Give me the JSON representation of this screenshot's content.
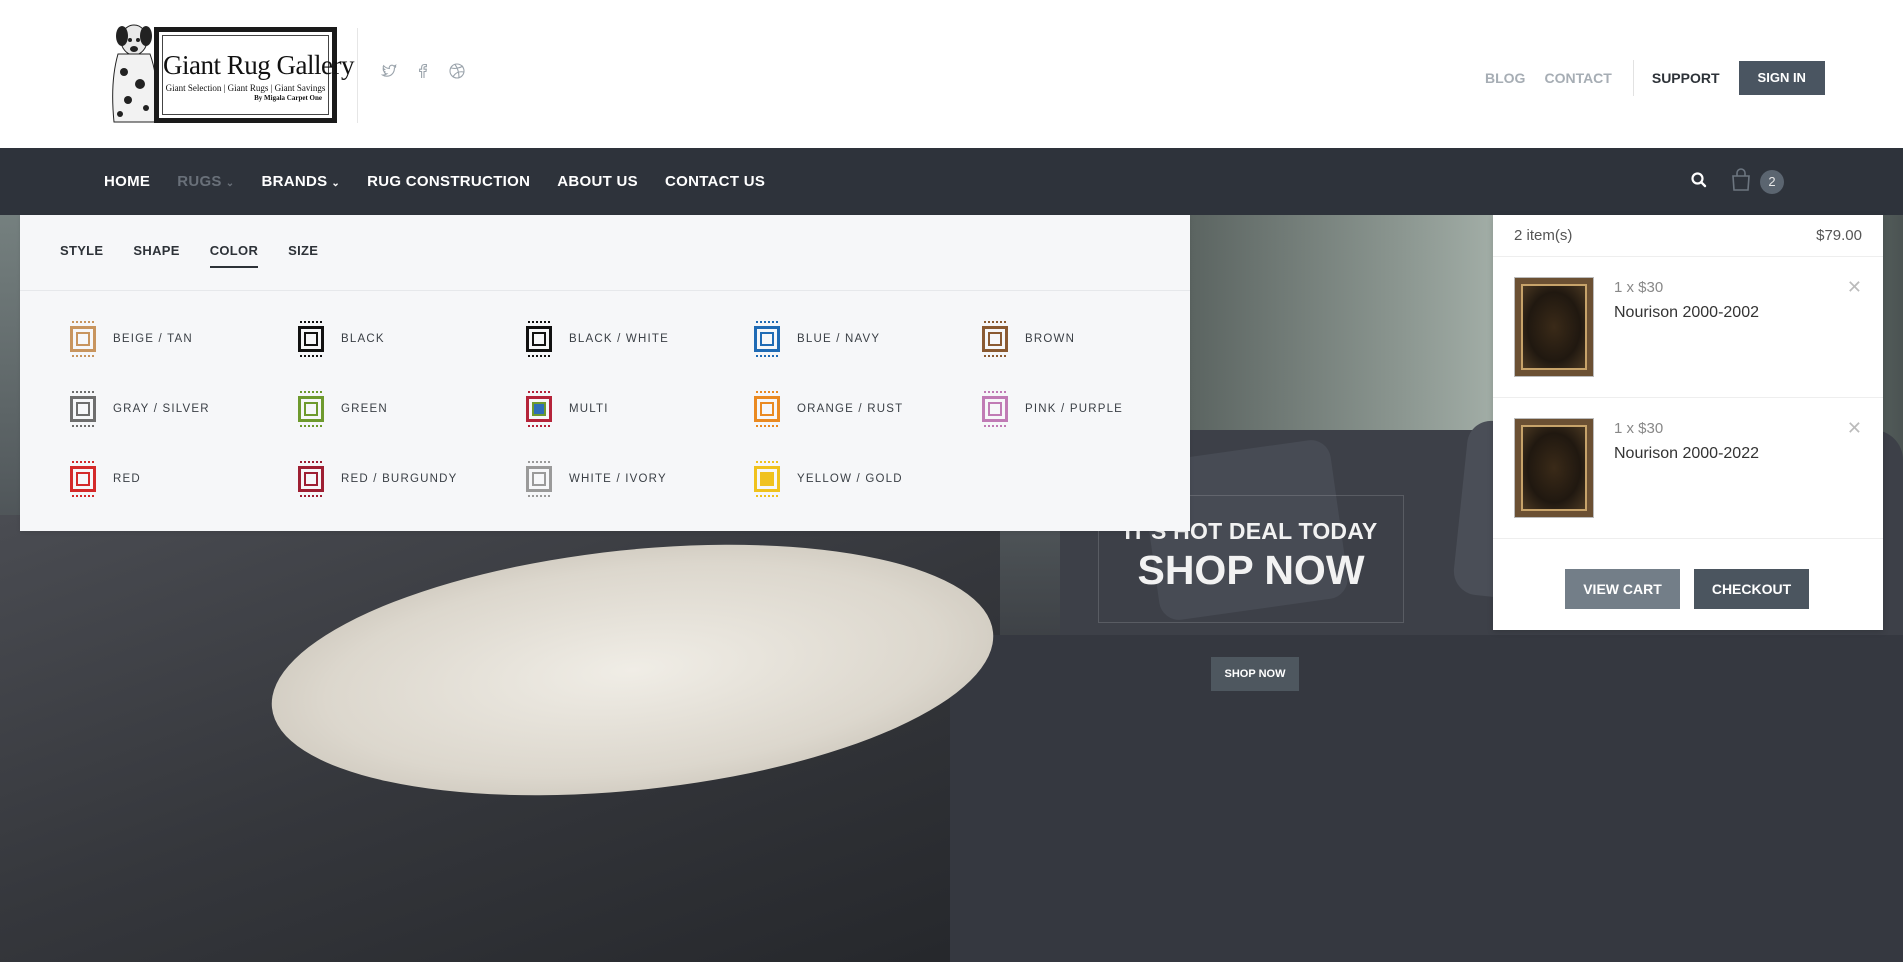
{
  "brand": {
    "logo_title": "Giant Rug Gallery",
    "logo_tagline": "Giant Selection | Giant Rugs | Giant Savings",
    "logo_byline": "By Migala Carpet One"
  },
  "social": [
    "twitter-icon",
    "facebook-icon",
    "dribbble-icon"
  ],
  "toplinks": {
    "blog": "BLOG",
    "contact": "CONTACT",
    "support": "SUPPORT",
    "signin": "SIGN IN"
  },
  "nav": {
    "items": [
      "HOME",
      "RUGS",
      "BRANDS",
      "RUG CONSTRUCTION",
      "ABOUT US",
      "CONTACT US"
    ],
    "cart_count": "2"
  },
  "mega": {
    "tabs": [
      "STYLE",
      "SHAPE",
      "COLOR",
      "SIZE"
    ],
    "active_tab": "COLOR",
    "colors": [
      {
        "label": "BEIGE / TAN",
        "color": "#c8955f"
      },
      {
        "label": "BLACK",
        "color": "#111111"
      },
      {
        "label": "BLACK / WHITE",
        "color": "#111111"
      },
      {
        "label": "BLUE / NAVY",
        "color": "#1f6bb5"
      },
      {
        "label": "BROWN",
        "color": "#8a5a32"
      },
      {
        "label": "GRAY / SILVER",
        "color": "#6e6e6e"
      },
      {
        "label": "GREEN",
        "color": "#6e9a2e"
      },
      {
        "label": "MULTI",
        "color": "#b5243a"
      },
      {
        "label": "ORANGE / RUST",
        "color": "#ea8a22"
      },
      {
        "label": "PINK / PURPLE",
        "color": "#c07bb5"
      },
      {
        "label": "RED",
        "color": "#d42a2a"
      },
      {
        "label": "RED / BURGUNDY",
        "color": "#9e1f33"
      },
      {
        "label": "WHITE / IVORY",
        "color": "#9a9a9a"
      },
      {
        "label": "YELLOW / GOLD",
        "color": "#f0c21e"
      }
    ]
  },
  "hero": {
    "tagline": "IT'S HOT DEAL TODAY",
    "headline": "SHOP NOW",
    "button": "SHOP NOW"
  },
  "cart": {
    "count_label": "2 item(s)",
    "total": "$79.00",
    "items": [
      {
        "qty": "1 x $30",
        "name": "Nourison 2000-2002"
      },
      {
        "qty": "1 x $30",
        "name": "Nourison 2000-2022"
      }
    ],
    "view_cart": "VIEW CART",
    "checkout": "CHECKOUT"
  }
}
